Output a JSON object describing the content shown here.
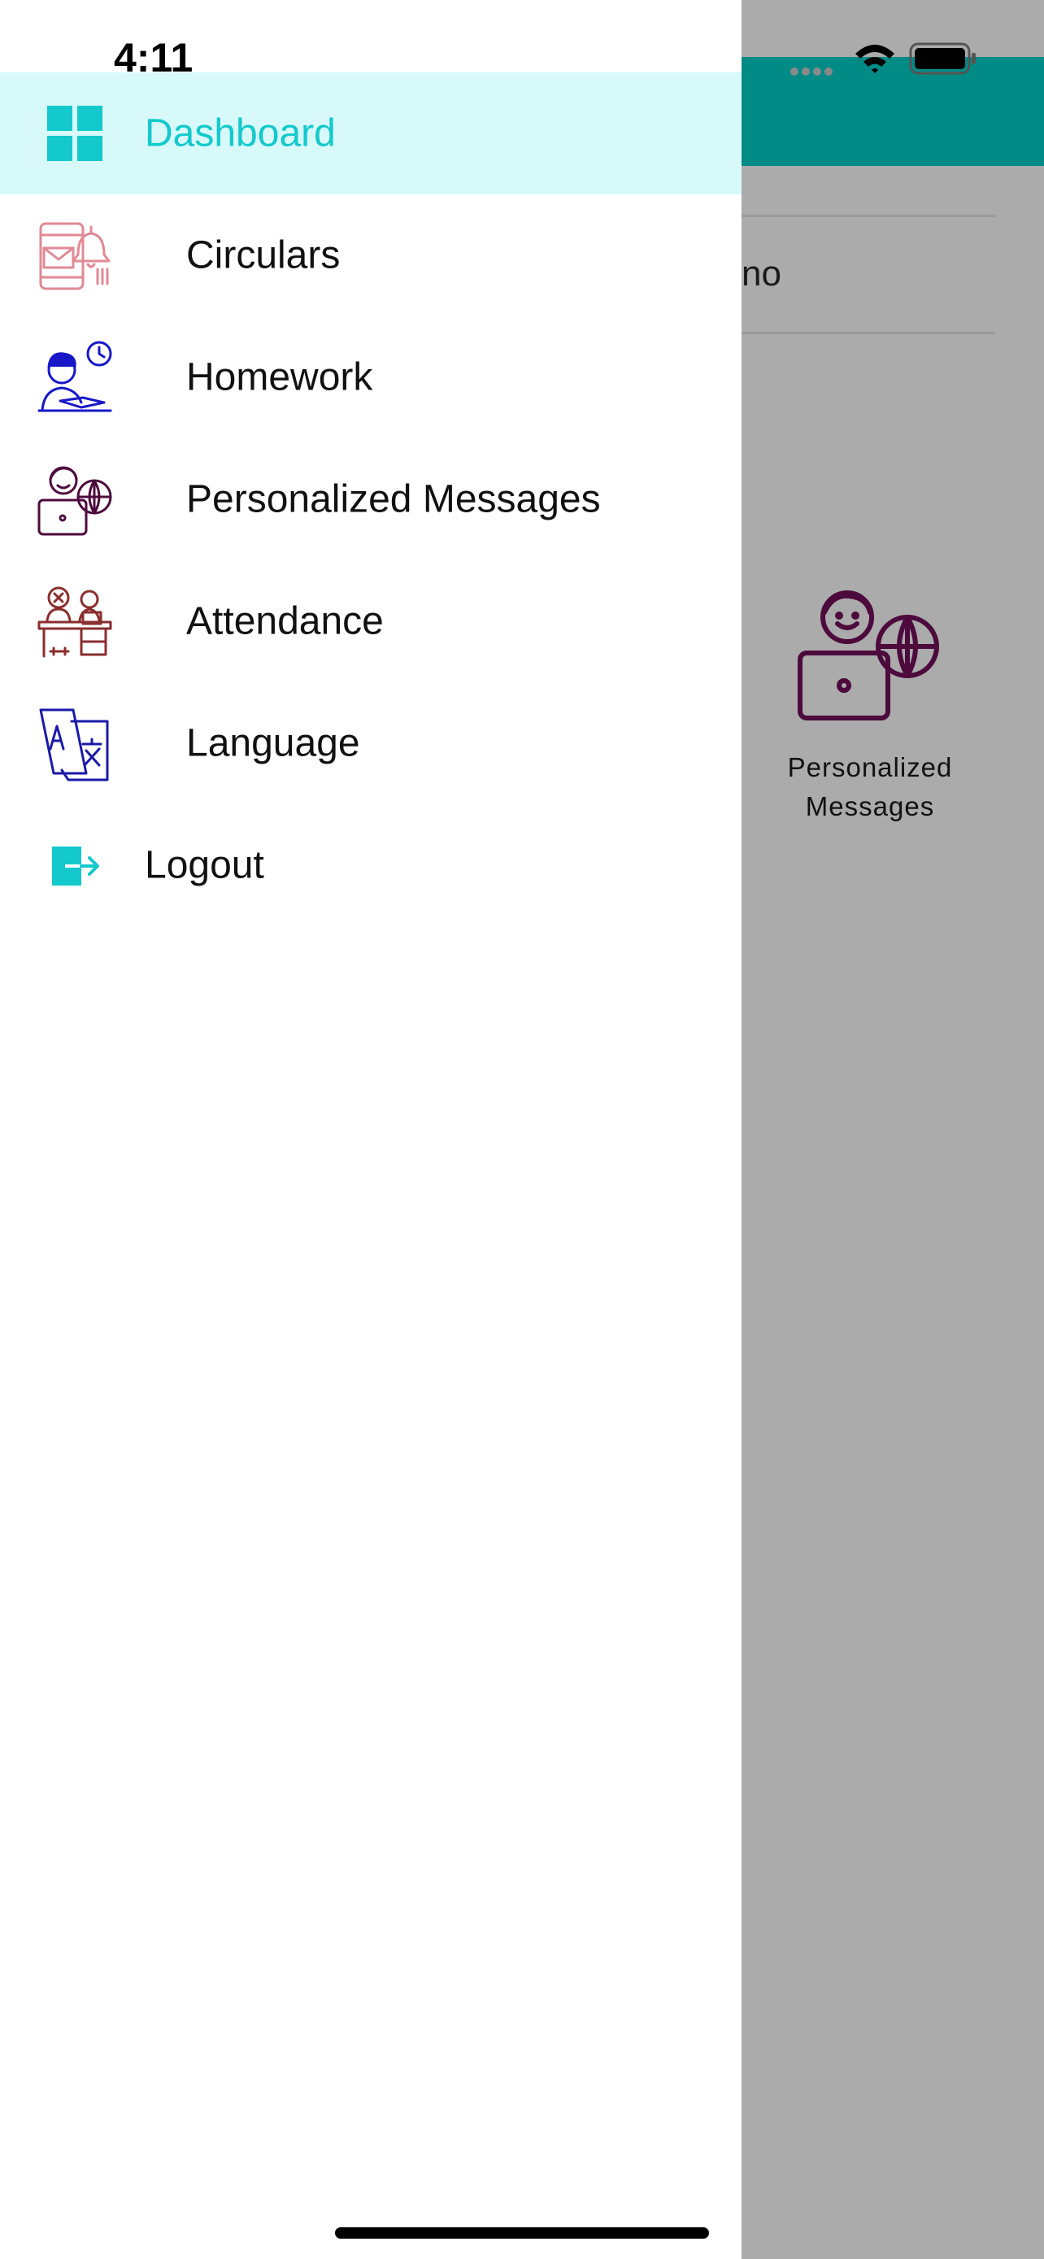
{
  "status_bar": {
    "time": "4:11"
  },
  "background_screen": {
    "partial_text": "no",
    "card": {
      "label": "Personalized\nMessages"
    }
  },
  "drawer": {
    "items": [
      {
        "label": "Dashboard",
        "icon": "dashboard-grid-icon",
        "active": true
      },
      {
        "label": "Circulars",
        "icon": "circular-notification-icon"
      },
      {
        "label": "Homework",
        "icon": "homework-student-icon"
      },
      {
        "label": "Personalized Messages",
        "icon": "personalized-messages-icon"
      },
      {
        "label": "Attendance",
        "icon": "attendance-desk-icon"
      },
      {
        "label": "Language",
        "icon": "language-translate-icon"
      },
      {
        "label": "Logout",
        "icon": "logout-icon"
      }
    ]
  },
  "colors": {
    "accent": "#13c9cc",
    "active_bg": "#d8f9f9",
    "app_bar": "#018b87",
    "overlay": "#ababab"
  }
}
